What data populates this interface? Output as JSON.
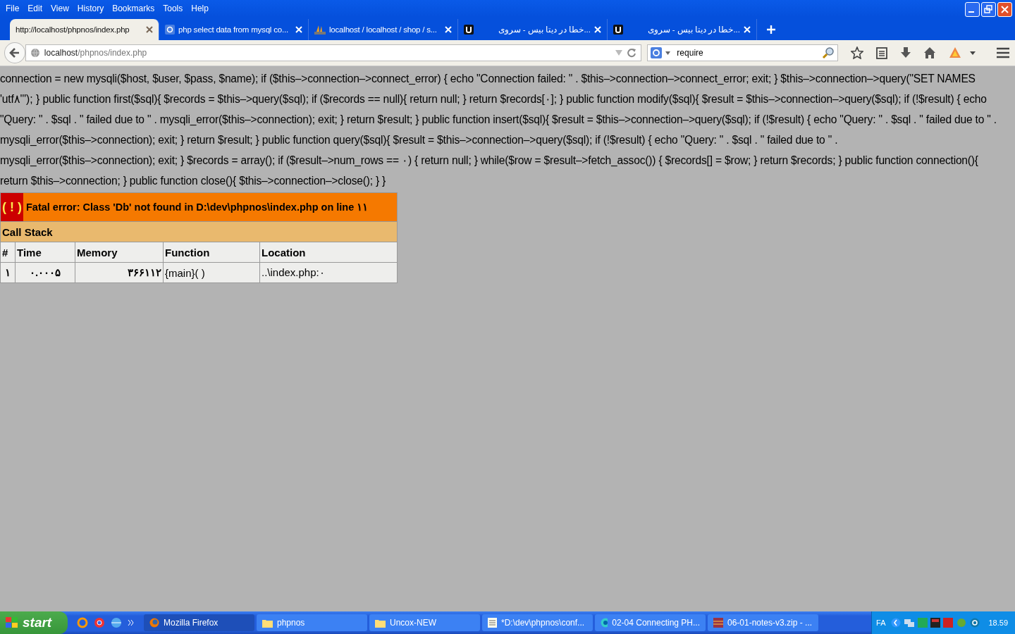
{
  "menu": [
    "File",
    "Edit",
    "View",
    "History",
    "Bookmarks",
    "Tools",
    "Help"
  ],
  "tabs": [
    {
      "title": "http://localhost/phpnos/index.php",
      "selected": true
    },
    {
      "title": "php select data from mysql co...",
      "selected": false
    },
    {
      "title": "localhost / localhost / shop / s...",
      "selected": false
    },
    {
      "title": "...خطا در دیتا بیس - سروی",
      "selected": false
    },
    {
      "title": "...خطا در دیتا بیس - سروی",
      "selected": false
    }
  ],
  "address": {
    "host": "localhost",
    "path": "/phpnos/index.php"
  },
  "search": {
    "value": "require"
  },
  "code_lines": [
    "connection = new mysqli($host, $user, $pass, $name); if ($this–>connection–>connect_error) { echo \"Connection failed: \" . $this–>connection–>connect_error; exit; } $this–>connection–>query(\"SET NAMES",
    "'utf۸'\"); } public function first($sql){ $records = $this–>query($sql); if ($records == null){ return null; } return $records[۰]; } public function modify($sql){ $result = $this–>connection–>query($sql); if (!$result) { echo",
    "\"Query: \" . $sql . \" failed due to \" . mysqli_error($this–>connection); exit; } return $result; } public function insert($sql){ $result = $this–>connection–>query($sql); if (!$result) { echo \"Query: \" . $sql . \" failed due to \" .",
    "mysqli_error($this–>connection); exit; } return $result; } public function query($sql){ $result = $this–>connection–>query($sql); if (!$result) { echo \"Query: \" . $sql . \" failed due to \" .",
    "mysqli_error($this–>connection); exit; } $records = array(); if ($result–>num_rows == ۰) { return null; } while($row = $result–>fetch_assoc()) { $records[] = $row; } return $records; } public function connection(){",
    "return $this–>connection; } public function close(){ $this–>connection–>close(); } }"
  ],
  "error": {
    "icon_text": "( ! )",
    "message": "Fatal error: Class 'Db' not found in D:\\dev\\phpnos\\index.php on line ۱۱",
    "stack_title": "Call Stack",
    "columns": [
      "#",
      "Time",
      "Memory",
      "Function",
      "Location"
    ],
    "rows": [
      {
        "num": "۱",
        "time": "۰.۰۰۰۵",
        "memory": "۳۶۶۱۱۲",
        "function": "{main}( )",
        "location": "..\\index.php:۰"
      }
    ]
  },
  "taskbar": {
    "start": "start",
    "items": [
      {
        "label": "Mozilla Firefox",
        "selected": true
      },
      {
        "label": "phpnos",
        "selected": false
      },
      {
        "label": "Uncox-NEW",
        "selected": false
      },
      {
        "label": "*D:\\dev\\phpnos\\conf...",
        "selected": false
      },
      {
        "label": "02-04 Connecting PH...",
        "selected": false
      },
      {
        "label": "06-01-notes-v3.zip - ...",
        "selected": false
      }
    ],
    "language": "FA",
    "clock": "18.59"
  }
}
